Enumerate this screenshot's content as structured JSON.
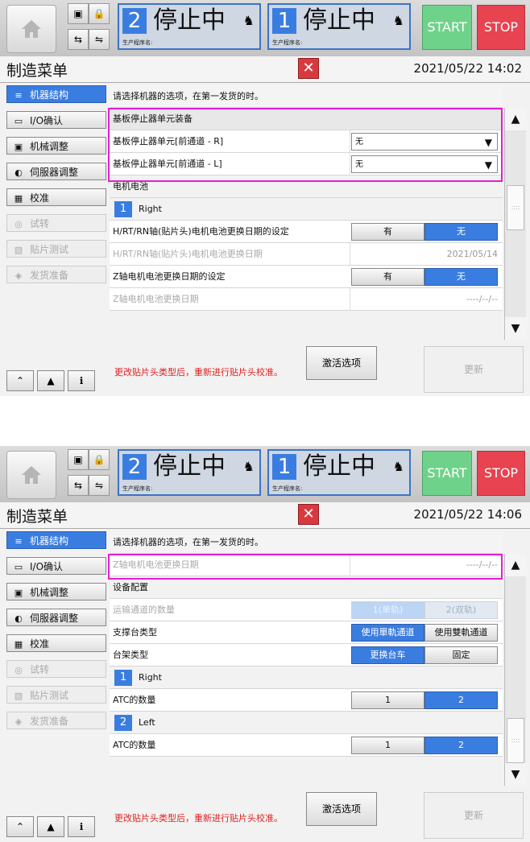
{
  "screens": [
    {
      "lanes": [
        {
          "num": "2",
          "state": "停止中",
          "prog_label": "生产程序名:"
        },
        {
          "num": "1",
          "state": "停止中",
          "prog_label": "生产程序名:"
        }
      ],
      "start": "START",
      "stop": "STOP",
      "title": "制造菜单",
      "datetime": "2021/05/22 14:02",
      "sidebar": [
        {
          "label": "机器结构",
          "state": "active"
        },
        {
          "label": "I/O确认",
          "state": "normal"
        },
        {
          "label": "机械调整",
          "state": "normal"
        },
        {
          "label": "伺服器调整",
          "state": "normal"
        },
        {
          "label": "校准",
          "state": "normal"
        },
        {
          "label": "试转",
          "state": "disabled"
        },
        {
          "label": "贴片测试",
          "state": "disabled"
        },
        {
          "label": "发货准备",
          "state": "disabled"
        }
      ],
      "message": "请选择机器的选项，在第一发货的时。",
      "rows": [
        {
          "label": "基板停止器单元装备",
          "kind": "header"
        },
        {
          "label": "基板停止器单元[前通道 - R]",
          "kind": "select",
          "value": "无"
        },
        {
          "label": "基板停止器单元[前通道 - L]",
          "kind": "select",
          "value": "无"
        },
        {
          "label": "电机电池",
          "kind": "section"
        },
        {
          "badge": "1",
          "label": "Right",
          "kind": "badge"
        },
        {
          "label": "H/RT/RN轴(贴片头)电机电池更换日期的设定",
          "kind": "seg",
          "opts": [
            "有",
            "无"
          ],
          "on": 1
        },
        {
          "label": "H/RT/RN轴(贴片头)电机电池更换日期",
          "kind": "value",
          "value": "2021/05/14",
          "disabled": true
        },
        {
          "label": "Z轴电机电池更换日期的设定",
          "kind": "seg",
          "opts": [
            "有",
            "无"
          ],
          "on": 1
        },
        {
          "label": "Z轴电机电池更换日期",
          "kind": "value",
          "value": "----/--/--",
          "disabled": true
        }
      ],
      "warning": "更改贴片头类型后，重新进行贴片头校准。",
      "activate": "激活选项",
      "update": "更新"
    },
    {
      "lanes": [
        {
          "num": "2",
          "state": "停止中",
          "prog_label": "生产程序名:"
        },
        {
          "num": "1",
          "state": "停止中",
          "prog_label": "生产程序名:"
        }
      ],
      "start": "START",
      "stop": "STOP",
      "title": "制造菜单",
      "datetime": "2021/05/22 14:06",
      "sidebar": [
        {
          "label": "机器结构",
          "state": "active"
        },
        {
          "label": "I/O确认",
          "state": "normal"
        },
        {
          "label": "机械调整",
          "state": "normal"
        },
        {
          "label": "伺服器调整",
          "state": "normal"
        },
        {
          "label": "校准",
          "state": "normal"
        },
        {
          "label": "试转",
          "state": "disabled"
        },
        {
          "label": "贴片测试",
          "state": "disabled"
        },
        {
          "label": "发货准备",
          "state": "disabled"
        }
      ],
      "message": "请选择机器的选项，在第一发货的时。",
      "rows": [
        {
          "label": "Z轴电机电池更换日期",
          "kind": "value",
          "value": "----/--/--",
          "disabled": true
        },
        {
          "label": "设备配置",
          "kind": "section"
        },
        {
          "label": "运输通道的数量",
          "kind": "seg",
          "opts": [
            "1(单轨)",
            "2(双轨)"
          ],
          "on": 0,
          "disabled": true
        },
        {
          "label": "支撑台类型",
          "kind": "seg",
          "opts": [
            "使用單軌通道",
            "使用雙軌通道"
          ],
          "on": 0
        },
        {
          "label": "台架类型",
          "kind": "seg",
          "opts": [
            "更换台车",
            "固定"
          ],
          "on": 0
        },
        {
          "badge": "1",
          "label": "Right",
          "kind": "badge"
        },
        {
          "label": "ATC的数量",
          "kind": "seg",
          "opts": [
            "1",
            "2"
          ],
          "on": 1
        },
        {
          "badge": "2",
          "label": "Left",
          "kind": "badge"
        },
        {
          "label": "ATC的数量",
          "kind": "seg",
          "opts": [
            "1",
            "2"
          ],
          "on": 1
        }
      ],
      "warning": "更改贴片头类型后，重新进行贴片头校准。",
      "activate": "激活选项",
      "update": "更新"
    }
  ]
}
